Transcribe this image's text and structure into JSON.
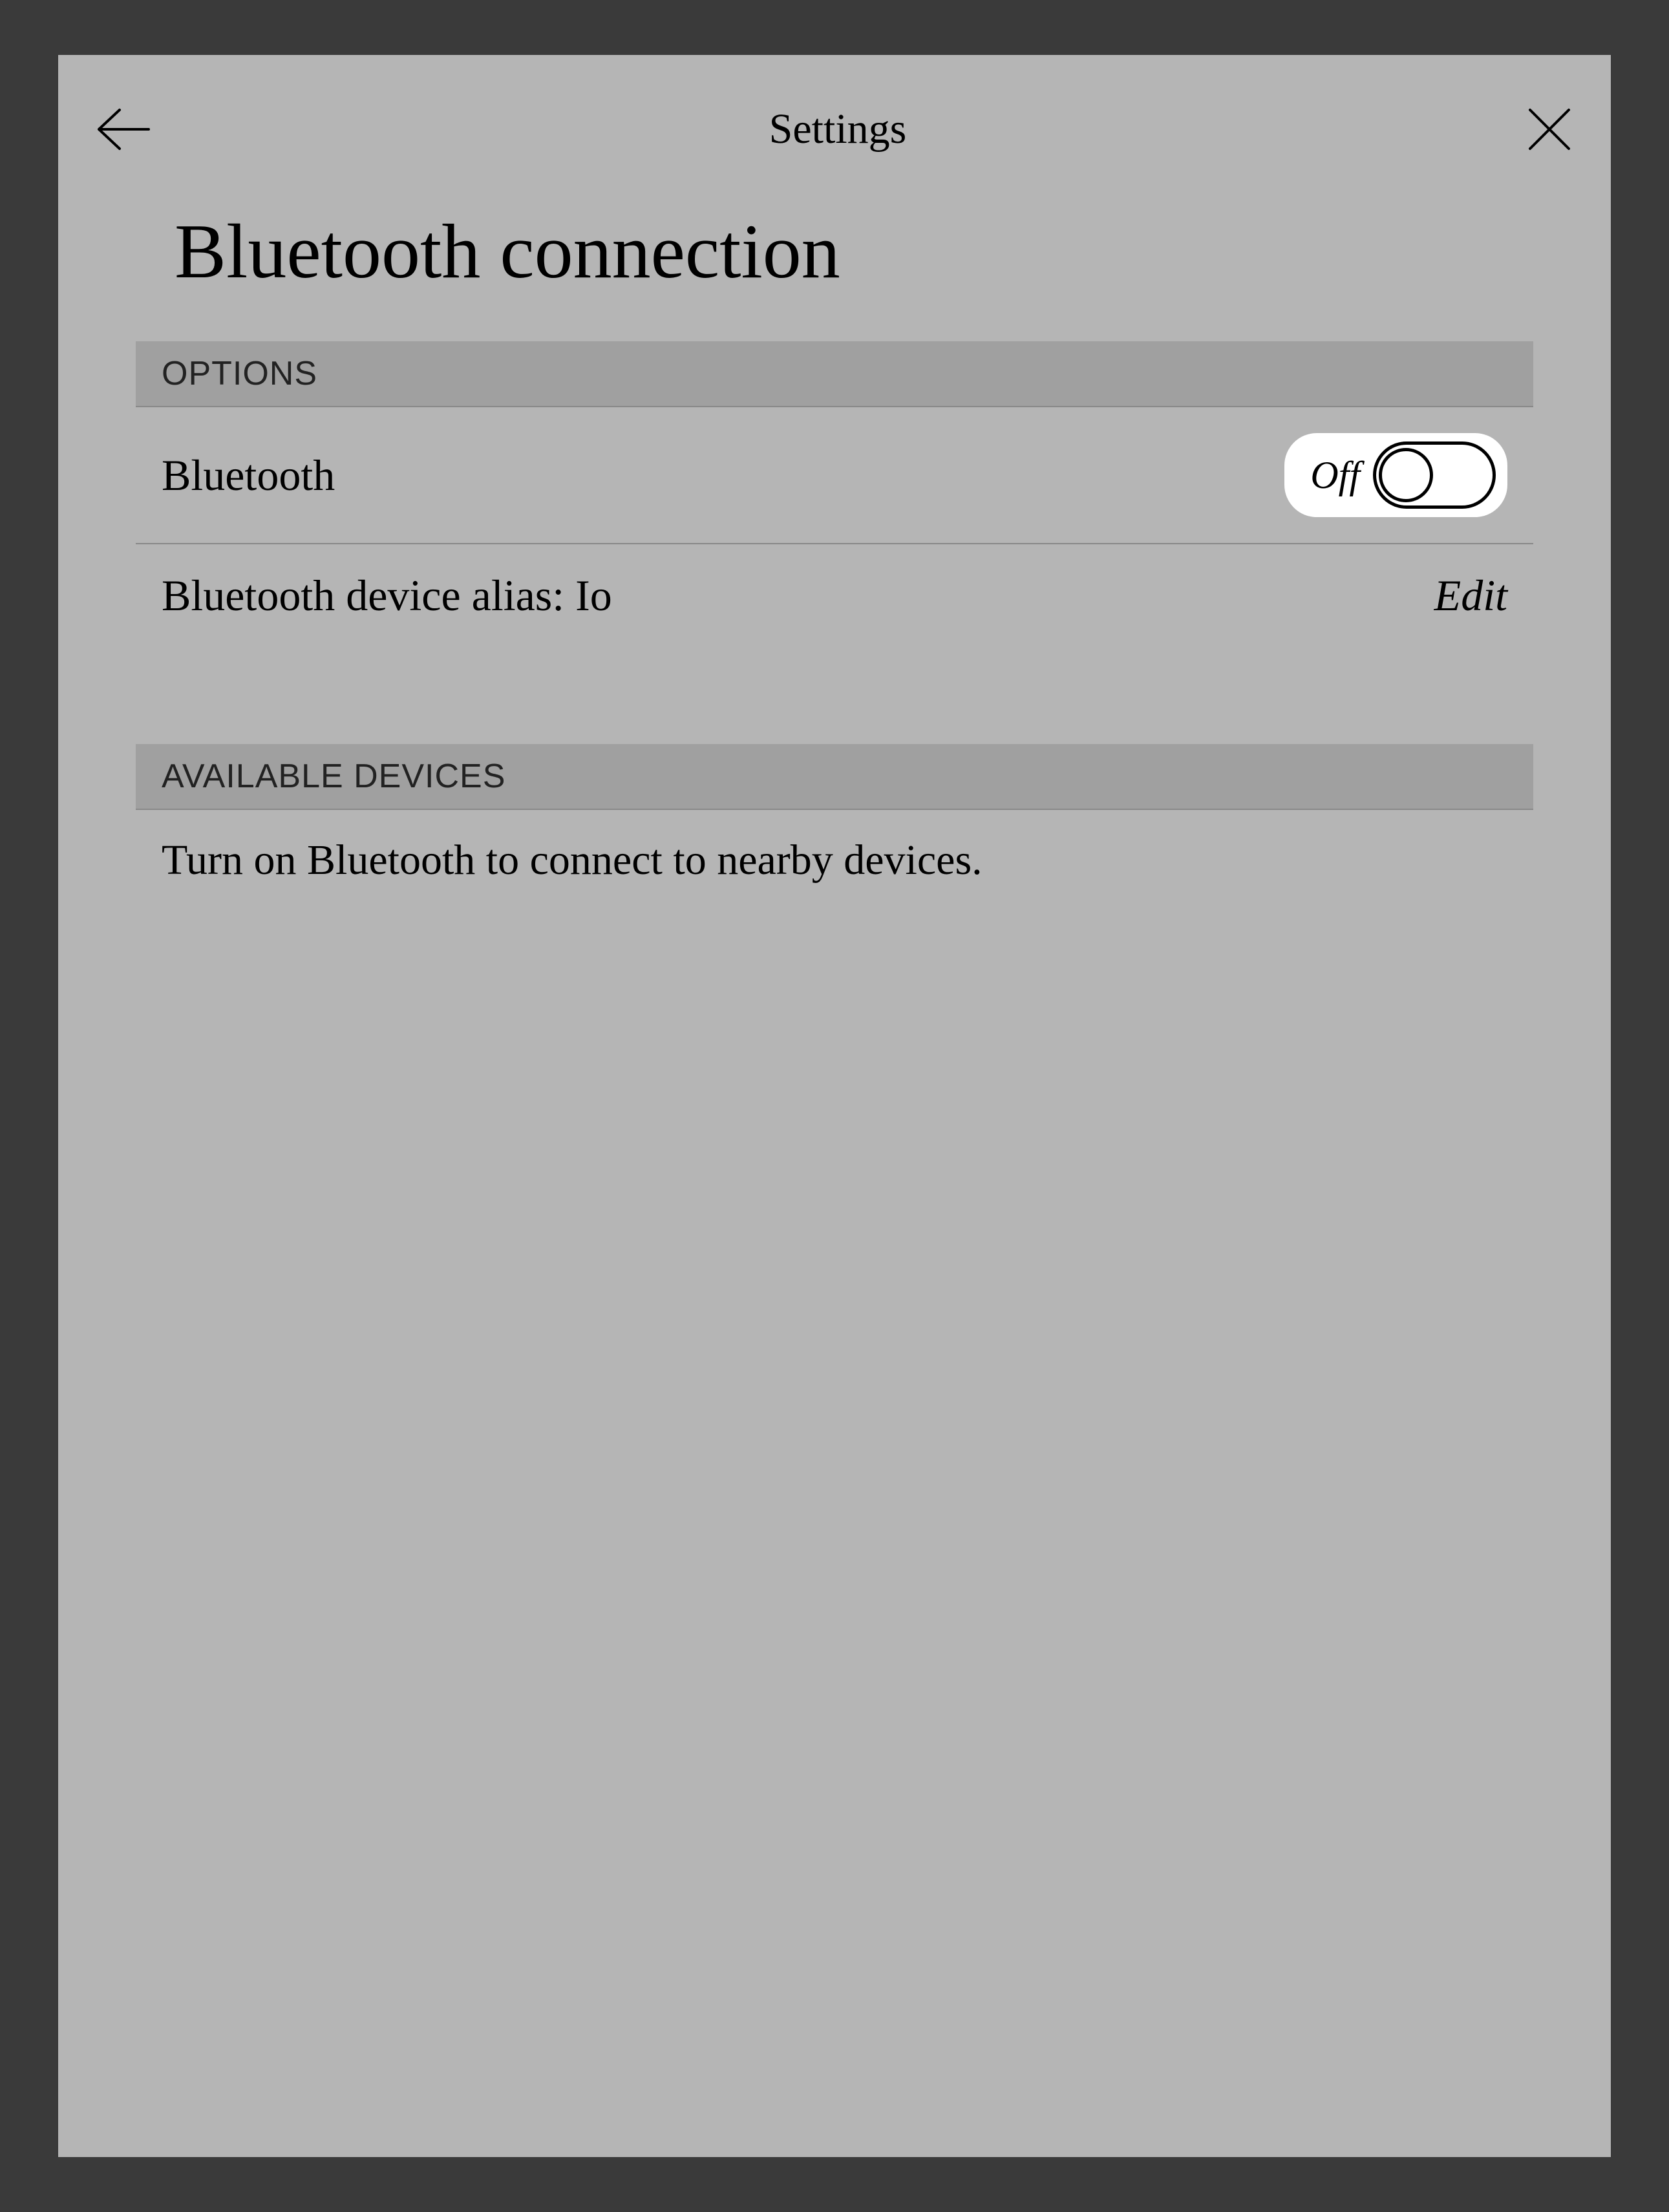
{
  "header": {
    "title": "Settings"
  },
  "page": {
    "title": "Bluetooth connection"
  },
  "sections": {
    "options": {
      "header": "OPTIONS",
      "bluetooth_label": "Bluetooth",
      "toggle_state": "Off",
      "alias_label": "Bluetooth device alias: Io",
      "edit_action": "Edit"
    },
    "available": {
      "header": "AVAILABLE DEVICES",
      "info": "Turn on Bluetooth to connect to nearby devices."
    }
  }
}
